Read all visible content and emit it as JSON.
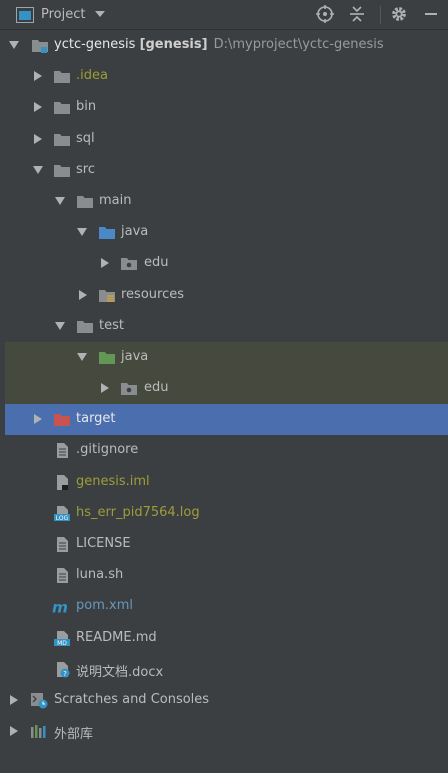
{
  "toolbar": {
    "title": "Project",
    "icons": [
      "project-icon",
      "dropdown-icon",
      "locate-icon",
      "collapse-icon",
      "gear-icon",
      "minimize-icon"
    ]
  },
  "tree": {
    "root": {
      "name": "yctc-genesis",
      "module": "[genesis]",
      "path": "D:\\myproject\\yctc-genesis"
    },
    "items": {
      "idea": ".idea",
      "bin": "bin",
      "sql": "sql",
      "src": "src",
      "main": "main",
      "main_java": "java",
      "main_edu": "edu",
      "resources": "resources",
      "test": "test",
      "test_java": "java",
      "test_edu": "edu",
      "target": "target",
      "gitignore": ".gitignore",
      "iml": "genesis.iml",
      "log": "hs_err_pid7564.log",
      "license": "LICENSE",
      "luna": "luna.sh",
      "pom": "pom.xml",
      "readme": "README.md",
      "docx": "说明文档.docx",
      "scratches": "Scratches and Consoles",
      "external": "外部库"
    }
  },
  "colors": {
    "background": "#3c3f41",
    "selection": "#4b6eaf",
    "highlight": "#45493e",
    "folder": "#8a8d8f",
    "source_folder": "#4a88c7",
    "test_folder": "#629755",
    "excluded_folder": "#c75450",
    "modified_text": "#9e9d3a",
    "link_text": "#6897bb"
  }
}
